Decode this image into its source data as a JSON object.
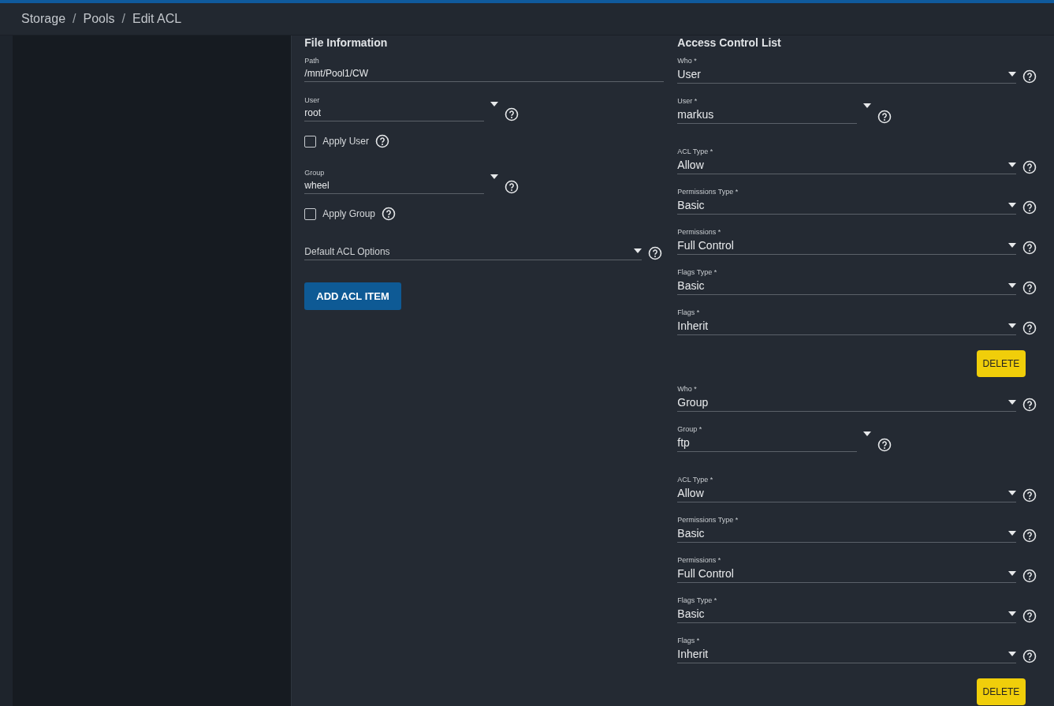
{
  "breadcrumb": [
    {
      "label": "Storage",
      "separator": "/"
    },
    {
      "label": "Pools",
      "separator": "/"
    },
    {
      "label": "Edit ACL"
    }
  ],
  "file_information": {
    "title": "File Information",
    "fields": [
      {
        "kind": "text",
        "label": "Path",
        "value": "/mnt/Pool1/CW"
      },
      {
        "kind": "short-select",
        "label": "User",
        "value": "root"
      },
      {
        "kind": "checkbox",
        "label": "Apply User",
        "checked": false
      },
      {
        "kind": "short-select",
        "label": "Group",
        "value": "wheel"
      },
      {
        "kind": "checkbox",
        "label": "Apply Group",
        "checked": false
      },
      {
        "kind": "select",
        "placeholder": "Default ACL Options"
      }
    ],
    "button": "ADD ACL ITEM"
  },
  "access_control_list": {
    "title": "Access Control List",
    "entries": [
      {
        "fields": [
          {
            "kind": "select",
            "label": "Who *",
            "value": "User"
          },
          {
            "kind": "short-select",
            "label": "User *",
            "value": "markus"
          },
          {
            "kind": "select",
            "label": "ACL Type *",
            "value": "Allow"
          },
          {
            "kind": "select",
            "label": "Permissions Type *",
            "value": "Basic"
          },
          {
            "kind": "select",
            "label": "Permissions *",
            "value": "Full Control"
          },
          {
            "kind": "select",
            "label": "Flags Type *",
            "value": "Basic"
          },
          {
            "kind": "select",
            "label": "Flags *",
            "value": "Inherit"
          }
        ],
        "button": "DELETE"
      },
      {
        "fields": [
          {
            "kind": "select",
            "label": "Who *",
            "value": "Group"
          },
          {
            "kind": "short-select",
            "label": "Group *",
            "value": "ftp"
          },
          {
            "kind": "select",
            "label": "ACL Type *",
            "value": "Allow"
          },
          {
            "kind": "select",
            "label": "Permissions Type *",
            "value": "Basic"
          },
          {
            "kind": "select",
            "label": "Permissions *",
            "value": "Full Control"
          },
          {
            "kind": "select",
            "label": "Flags Type *",
            "value": "Basic"
          },
          {
            "kind": "select",
            "label": "Flags *",
            "value": "Inherit"
          }
        ],
        "button": "DELETE"
      }
    ]
  }
}
